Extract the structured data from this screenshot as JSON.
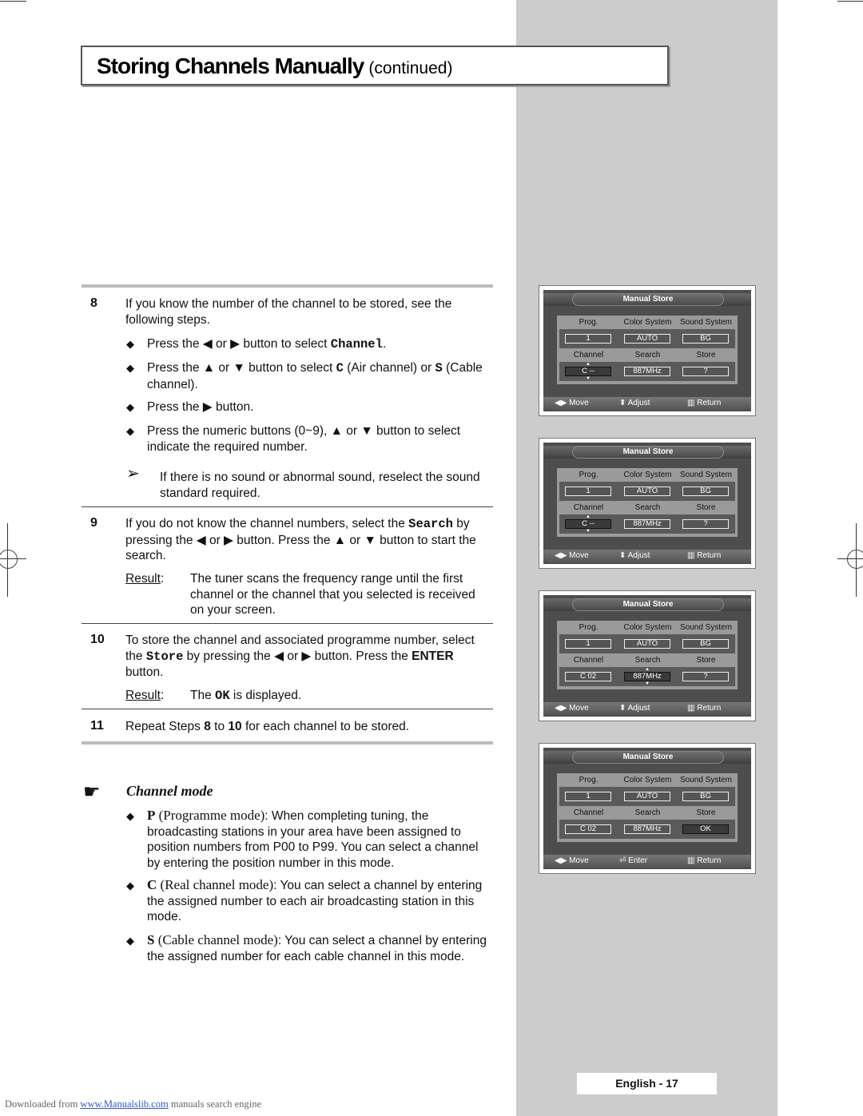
{
  "header": {
    "title": "Storing Channels Manually",
    "subtitle": "(continued)"
  },
  "steps": {
    "s8": {
      "num": "8",
      "intro": "If you know the number of the channel to be stored, see the following steps.",
      "bullets": [
        {
          "pre": "Press the ◀ or ▶ button to select ",
          "code": "Channel",
          "post": "."
        },
        {
          "pre": "Press the ▲ or ▼ button to select ",
          "code": "C",
          "mid": " (Air channel) or ",
          "code2": "S",
          "post": " (Cable channel)."
        },
        {
          "pre": "Press the ▶ button."
        },
        {
          "pre": "Press the numeric buttons (0~9), ▲ or ▼ button to select indicate the required number."
        }
      ],
      "note": "If there is no sound or abnormal sound, reselect the sound standard required."
    },
    "s9": {
      "num": "9",
      "pre": "If you do not know the channel numbers, select the ",
      "code": "Search",
      "post": " by pressing the ◀ or ▶ button. Press the ▲ or ▼ button to start the search.",
      "result_label": "Result",
      "result": "The tuner scans the frequency range until the first channel or the channel that you selected is received on your screen."
    },
    "s10": {
      "num": "10",
      "pre": "To store the channel and associated programme number, select the ",
      "code": "Store",
      "mid": " by pressing the ◀ or ▶ button. Press the ",
      "bold": "ENTER",
      "post": " button.",
      "result_label": "Result",
      "result_pre": "The ",
      "result_code": "OK",
      "result_post": " is displayed."
    },
    "s11": {
      "num": "11",
      "pre": "Repeat Steps ",
      "b1": "8",
      "mid": " to ",
      "b2": "10",
      "post": " for each channel to be stored."
    }
  },
  "channel_mode": {
    "title": "Channel mode",
    "items": [
      {
        "key": "P",
        "name": " (Programme mode)",
        "text": ": When completing tuning, the broadcasting stations in your area have been assigned to position numbers from P00 to P99. You can select a channel by entering the position number in this mode."
      },
      {
        "key": "C",
        "name": " (Real channel mode)",
        "text": ": You can select a channel by entering the assigned number to each air broadcasting station in this mode."
      },
      {
        "key": "S",
        "name": " (Cable channel mode)",
        "text": ": You can select a channel by entering the assigned number for each cable channel in this mode."
      }
    ]
  },
  "screens": [
    {
      "title": "Manual Store",
      "labels": [
        "Prog.",
        "Color System",
        "Sound System",
        "Channel",
        "Search",
        "Store"
      ],
      "values": [
        "1",
        "AUTO",
        "BG",
        "C --",
        "887MHz",
        "?"
      ],
      "selected": "channel",
      "footer": [
        "Move",
        "Adjust",
        "Return"
      ]
    },
    {
      "title": "Manual Store",
      "labels": [
        "Prog.",
        "Color System",
        "Sound System",
        "Channel",
        "Search",
        "Store"
      ],
      "values": [
        "1",
        "AUTO",
        "BG",
        "C --",
        "887MHz",
        "?"
      ],
      "selected": "channel",
      "footer": [
        "Move",
        "Adjust",
        "Return"
      ]
    },
    {
      "title": "Manual Store",
      "labels": [
        "Prog.",
        "Color System",
        "Sound System",
        "Channel",
        "Search",
        "Store"
      ],
      "values": [
        "1",
        "AUTO",
        "BG",
        "C 02",
        "887MHz",
        "?"
      ],
      "selected": "search",
      "footer": [
        "Move",
        "Adjust",
        "Return"
      ]
    },
    {
      "title": "Manual Store",
      "labels": [
        "Prog.",
        "Color System",
        "Sound System",
        "Channel",
        "Search",
        "Store"
      ],
      "values": [
        "1",
        "AUTO",
        "BG",
        "C 02",
        "887MHz",
        "OK"
      ],
      "selected": "store",
      "footer": [
        "Move",
        "Enter",
        "Return"
      ]
    }
  ],
  "footer": {
    "page_label": "English - 17",
    "download_pre": "Downloaded from ",
    "download_link": "www.Manualslib.com",
    "download_post": " manuals search engine"
  }
}
